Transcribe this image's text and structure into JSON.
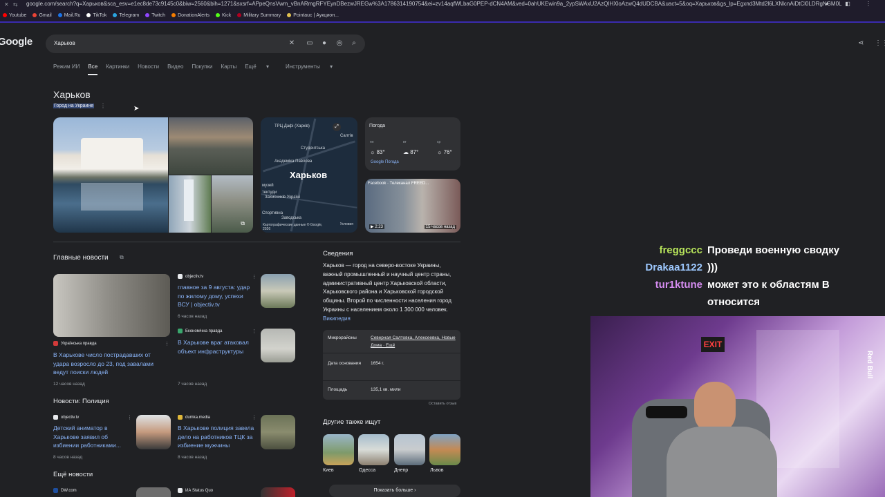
{
  "browser": {
    "url": "google.com/search?q=Харьков&sca_esv=e1ec8de73c9145c0&biw=2560&bih=1271&sxsrf=APpeQnsVwm_vBnARmgRFYEynDBezwJREGw%3A1786314190754&ei=zv14aqfWLbaG0PEP-dCN4AM&ved=0ahUKEwin9a_2ypSWAxU2AzQIHXloAzwQ4dUDCBA&uact=5&oq=Харьков&gs_lp=Egxnd3Mtd2l6LXNlcnAiDtCl0LDRgNGM0LrQvtCyMgQQIxgnMgoQI",
    "bookmarks": [
      "Youtube",
      "Gmail",
      "Mail.Ru",
      "TikTok",
      "Telegram",
      "Twitch",
      "DonationAlerts",
      "Kick",
      "Military Summary",
      "Pointauc | Аукцион..."
    ],
    "bookmark_colors": [
      "#ff0000",
      "#ea4335",
      "#1a73e8",
      "#ffffff",
      "#2aa3df",
      "#9146ff",
      "#f57c00",
      "#53fc18",
      "#b00020",
      "#e0c050"
    ]
  },
  "google": {
    "logo": "Google",
    "query": "Харьков",
    "tabs": [
      "Режим ИИ",
      "Все",
      "Картинки",
      "Новости",
      "Видео",
      "Покупки",
      "Карты",
      "Ещё",
      "Инструменты"
    ],
    "active_tab": "Все"
  },
  "entity": {
    "title": "Харьков",
    "subtitle": "Город на Украине"
  },
  "map": {
    "city": "Харьков",
    "labels": [
      "ТРЦ Дафі (Харків)",
      "Салтів",
      "Студентська",
      "Академіка Павлова",
      "музей",
      "тектуди",
      "Захисників Україні",
      "Спортивна",
      "Заводська"
    ],
    "footer": "Картографические данные © Google, 2026",
    "terms": "Условия"
  },
  "weather": {
    "title": "Погода",
    "days": [
      {
        "day": "пн",
        "temp": "83°",
        "icon": "sun-icon"
      },
      {
        "day": "вт",
        "temp": "87°",
        "icon": "cloud-icon"
      },
      {
        "day": "ср",
        "temp": "76°",
        "icon": "sun-icon"
      }
    ],
    "source": "Google Погода"
  },
  "video": {
    "source": "Facebook · Телеканал FREED...",
    "duration": "2:23",
    "ago": "15 часов назад"
  },
  "top_news": {
    "title": "Главные новости",
    "main": {
      "source": "Українська правда",
      "text": "В Харькове число пострадавших от удара возросло до 23, под завалами ведут поиски людей",
      "time": "12 часов назад"
    },
    "items": [
      {
        "source": "objectiv.tv",
        "text": "главное за 9 августа: удар по жилому дому, успехи ВСУ | objectiv.tv",
        "time": "6 часов назад"
      },
      {
        "source": "Економічна правда",
        "text": "В Харькове враг атаковал объект инфраструктуры",
        "time": "7 часов назад"
      }
    ]
  },
  "police_news": {
    "title": "Новости: Полиция",
    "items": [
      {
        "source": "objectiv.tv",
        "text": "Детский аниматор в Харькове заявил об избиении работниками...",
        "time": "8 часов назад"
      },
      {
        "source": "dumka.media",
        "text": "В Харькове полиция завела дело на работников ТЦК за избиение мужчины",
        "time": "8 часов назад"
      }
    ]
  },
  "more_news": {
    "title": "Ещё новости",
    "sources": [
      "DW.com",
      "ИА Status Quo"
    ]
  },
  "info": {
    "title": "Сведения",
    "text": "Харьков — город на северо-востоке Украины, важный промышленный и научный центр страны, административный центр Харьковской области, Харьковского района и Харьковской городской общины. Второй по численности населения город Украины с населением около 1 300 000 человек.",
    "wiki": "Википедия",
    "facts": [
      {
        "key": "Микрорайоны",
        "value": "Северная Салтовка, Алексеевка, Новые Дома · Ещё"
      },
      {
        "key": "Дата основания",
        "value": "1654 г."
      },
      {
        "key": "Площадь",
        "value": "135,1 кв. мили"
      }
    ],
    "feedback": "Оставить отзыв"
  },
  "others": {
    "title": "Другие также ищут",
    "items": [
      "Киев",
      "Одесса",
      "Днепр",
      "Львов"
    ],
    "more": "Показать больше"
  },
  "chat": [
    {
      "user": "freggccc",
      "color": "#b6e35a",
      "text": "Проведи военную сводку"
    },
    {
      "user": "Drakaa1122",
      "color": "#9ec9ff",
      "text": ")))"
    },
    {
      "user": "tur1ktune",
      "color": "#d58cf0",
      "text": "может это к областям В"
    },
    {
      "user": "",
      "color": "#ffffff",
      "text": "относится"
    }
  ],
  "webcam": {
    "sign": "EXIT",
    "brand": "Red Bull"
  }
}
